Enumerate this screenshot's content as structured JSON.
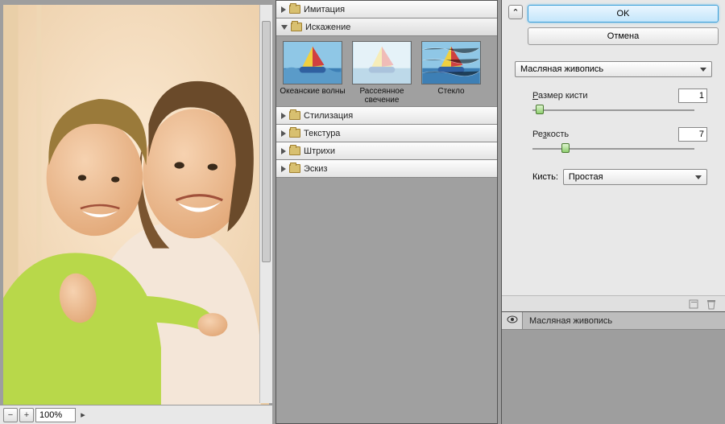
{
  "preview": {
    "zoom": "100%"
  },
  "categories": [
    {
      "label": "Имитация",
      "open": false
    },
    {
      "label": "Искажение",
      "open": true,
      "thumbs": [
        {
          "label": "Океанские волны"
        },
        {
          "label": "Рассеянное свечение"
        },
        {
          "label": "Стекло"
        }
      ]
    },
    {
      "label": "Стилизация",
      "open": false
    },
    {
      "label": "Текстура",
      "open": false
    },
    {
      "label": "Штрихи",
      "open": false
    },
    {
      "label": "Эскиз",
      "open": false
    }
  ],
  "buttons": {
    "ok": "OK",
    "cancel": "Отмена"
  },
  "filter": {
    "selected_name": "Масляная живопись",
    "params": [
      {
        "label": "Размер кисти",
        "value": "1",
        "pos_pct": 2
      },
      {
        "label": "Резкость",
        "value": "7",
        "pos_pct": 18
      }
    ],
    "brush_label": "Кисть:",
    "brush_value": "Простая"
  },
  "layers": {
    "active": "Масляная живопись"
  }
}
